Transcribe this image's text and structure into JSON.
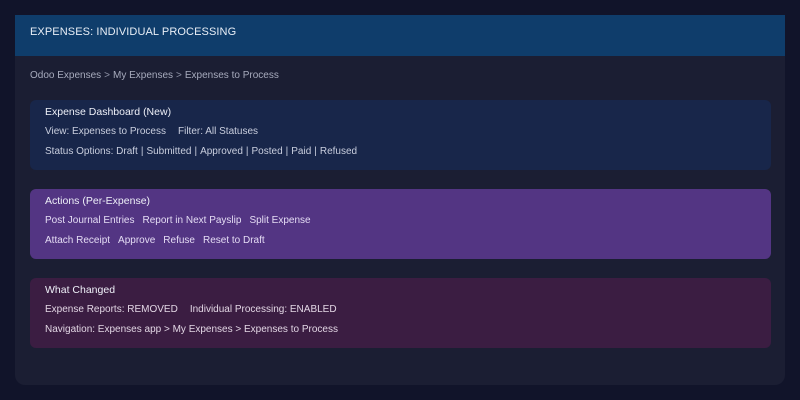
{
  "window": {
    "title": "EXPENSES: INDIVIDUAL PROCESSING"
  },
  "breadcrumb": {
    "items": [
      "Odoo Expenses",
      "My Expenses",
      "Expenses to Process"
    ],
    "separator": ">"
  },
  "dashboard": {
    "title": "Expense Dashboard (New)",
    "view": "View: Expenses to Process",
    "filter": "Filter: All Statuses",
    "status_label": "Status Options:",
    "statuses": [
      "Draft",
      "Submitted",
      "Approved",
      "Posted",
      "Paid",
      "Refused"
    ]
  },
  "actions": {
    "title": "Actions (Per-Expense)",
    "row1": [
      "Post Journal Entries",
      "Report in Next Payslip",
      "Split Expense"
    ],
    "row2": [
      "Attach Receipt",
      "Approve",
      "Refuse",
      "Reset to Draft"
    ]
  },
  "changes": {
    "title": "What Changed",
    "line1_a": "Expense Reports: REMOVED",
    "line1_b": "Individual Processing: ENABLED",
    "line2": "Navigation: Expenses app > My Expenses > Expenses to Process"
  },
  "colors": {
    "title_bar": "#0f3d6b",
    "dashboard_card": "#18264a",
    "actions_card": "#533583",
    "changes_card": "#3b1d42"
  }
}
